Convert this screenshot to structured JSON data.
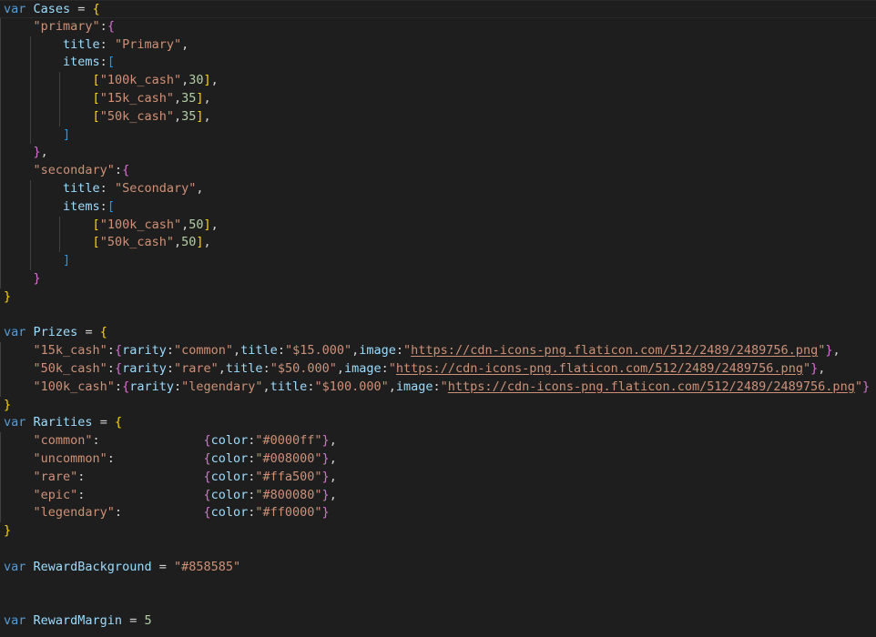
{
  "editor": {
    "language": "javascript",
    "background_color": "#1e1e1e",
    "foreground_color": "#d4d4d4",
    "font_size_px": 13.5,
    "line_height_px": 19.8,
    "current_line": 1,
    "theme_colors": {
      "keyword": "#569cd6",
      "variable": "#9cdcfe",
      "string": "#ce9178",
      "number": "#b5cea8",
      "punctuation": "#d4d4d4",
      "bracket_level_0": "#ffd700",
      "bracket_level_1": "#da70d6",
      "bracket_level_2": "#179fff",
      "indent_guide": "#404040",
      "current_line_border": "#282828"
    }
  },
  "source_values": {
    "cases": {
      "primary": {
        "title": "Primary",
        "items": [
          [
            "100k_cash",
            30
          ],
          [
            "15k_cash",
            35
          ],
          [
            "50k_cash",
            35
          ]
        ]
      },
      "secondary": {
        "title": "Secondary",
        "items": [
          [
            "100k_cash",
            50
          ],
          [
            "50k_cash",
            50
          ]
        ]
      }
    },
    "prizes": {
      "15k_cash": {
        "rarity": "common",
        "title": "$15.000",
        "image": "https://cdn-icons-png.flaticon.com/512/2489/2489756.png"
      },
      "50k_cash": {
        "rarity": "rare",
        "title": "$50.000",
        "image": "https://cdn-icons-png.flaticon.com/512/2489/2489756.png"
      },
      "100k_cash": {
        "rarity": "legendary",
        "title": "$100.000",
        "image": "https://cdn-icons-png.flaticon.com/512/2489/2489756.png"
      }
    },
    "rarities": {
      "common": "#0000ff",
      "uncommon": "#008000",
      "rare": "#ffa500",
      "epic": "#800080",
      "legendary": "#ff0000"
    },
    "reward_background": "#858585",
    "reward_margin": 5
  },
  "lines": [
    {
      "n": 1,
      "current": true,
      "guides": [],
      "tokens": [
        {
          "c": "t-kw",
          "t": "var"
        },
        {
          "c": "t-plain",
          "t": " "
        },
        {
          "c": "t-var",
          "t": "Cases"
        },
        {
          "c": "t-plain",
          "t": " = "
        },
        {
          "c": "t-b0",
          "t": "{"
        }
      ]
    },
    {
      "n": 2,
      "current": false,
      "guides": [
        0
      ],
      "tokens": [
        {
          "c": "t-plain",
          "t": "    "
        },
        {
          "c": "t-str",
          "t": "\"primary\""
        },
        {
          "c": "t-plain",
          "t": ":"
        },
        {
          "c": "t-b1",
          "t": "{"
        }
      ]
    },
    {
      "n": 3,
      "current": false,
      "guides": [
        0,
        1
      ],
      "tokens": [
        {
          "c": "t-plain",
          "t": "        "
        },
        {
          "c": "t-var",
          "t": "title"
        },
        {
          "c": "t-plain",
          "t": ": "
        },
        {
          "c": "t-str",
          "t": "\"Primary\""
        },
        {
          "c": "t-plain",
          "t": ","
        }
      ]
    },
    {
      "n": 4,
      "current": false,
      "guides": [
        0,
        1
      ],
      "tokens": [
        {
          "c": "t-plain",
          "t": "        "
        },
        {
          "c": "t-var",
          "t": "items"
        },
        {
          "c": "t-plain",
          "t": ":"
        },
        {
          "c": "t-b2",
          "t": "["
        }
      ]
    },
    {
      "n": 5,
      "current": false,
      "guides": [
        0,
        1,
        2
      ],
      "tokens": [
        {
          "c": "t-plain",
          "t": "            "
        },
        {
          "c": "t-b0",
          "t": "["
        },
        {
          "c": "t-str",
          "t": "\"100k_cash\""
        },
        {
          "c": "t-plain",
          "t": ","
        },
        {
          "c": "t-num",
          "t": "30"
        },
        {
          "c": "t-b0",
          "t": "]"
        },
        {
          "c": "t-plain",
          "t": ","
        }
      ]
    },
    {
      "n": 6,
      "current": false,
      "guides": [
        0,
        1,
        2
      ],
      "tokens": [
        {
          "c": "t-plain",
          "t": "            "
        },
        {
          "c": "t-b0",
          "t": "["
        },
        {
          "c": "t-str",
          "t": "\"15k_cash\""
        },
        {
          "c": "t-plain",
          "t": ","
        },
        {
          "c": "t-num",
          "t": "35"
        },
        {
          "c": "t-b0",
          "t": "]"
        },
        {
          "c": "t-plain",
          "t": ","
        }
      ]
    },
    {
      "n": 7,
      "current": false,
      "guides": [
        0,
        1,
        2
      ],
      "tokens": [
        {
          "c": "t-plain",
          "t": "            "
        },
        {
          "c": "t-b0",
          "t": "["
        },
        {
          "c": "t-str",
          "t": "\"50k_cash\""
        },
        {
          "c": "t-plain",
          "t": ","
        },
        {
          "c": "t-num",
          "t": "35"
        },
        {
          "c": "t-b0",
          "t": "]"
        },
        {
          "c": "t-plain",
          "t": ","
        }
      ]
    },
    {
      "n": 8,
      "current": false,
      "guides": [
        0,
        1
      ],
      "tokens": [
        {
          "c": "t-plain",
          "t": "        "
        },
        {
          "c": "t-b2",
          "t": "]"
        }
      ]
    },
    {
      "n": 9,
      "current": false,
      "guides": [
        0
      ],
      "tokens": [
        {
          "c": "t-plain",
          "t": "    "
        },
        {
          "c": "t-b1",
          "t": "}"
        },
        {
          "c": "t-plain",
          "t": ","
        }
      ]
    },
    {
      "n": 10,
      "current": false,
      "guides": [
        0
      ],
      "tokens": [
        {
          "c": "t-plain",
          "t": "    "
        },
        {
          "c": "t-str",
          "t": "\"secondary\""
        },
        {
          "c": "t-plain",
          "t": ":"
        },
        {
          "c": "t-b1",
          "t": "{"
        }
      ]
    },
    {
      "n": 11,
      "current": false,
      "guides": [
        0,
        1
      ],
      "tokens": [
        {
          "c": "t-plain",
          "t": "        "
        },
        {
          "c": "t-var",
          "t": "title"
        },
        {
          "c": "t-plain",
          "t": ": "
        },
        {
          "c": "t-str",
          "t": "\"Secondary\""
        },
        {
          "c": "t-plain",
          "t": ","
        }
      ]
    },
    {
      "n": 12,
      "current": false,
      "guides": [
        0,
        1
      ],
      "tokens": [
        {
          "c": "t-plain",
          "t": "        "
        },
        {
          "c": "t-var",
          "t": "items"
        },
        {
          "c": "t-plain",
          "t": ":"
        },
        {
          "c": "t-b2",
          "t": "["
        }
      ]
    },
    {
      "n": 13,
      "current": false,
      "guides": [
        0,
        1,
        2
      ],
      "tokens": [
        {
          "c": "t-plain",
          "t": "            "
        },
        {
          "c": "t-b0",
          "t": "["
        },
        {
          "c": "t-str",
          "t": "\"100k_cash\""
        },
        {
          "c": "t-plain",
          "t": ","
        },
        {
          "c": "t-num",
          "t": "50"
        },
        {
          "c": "t-b0",
          "t": "]"
        },
        {
          "c": "t-plain",
          "t": ","
        }
      ]
    },
    {
      "n": 14,
      "current": false,
      "guides": [
        0,
        1,
        2
      ],
      "tokens": [
        {
          "c": "t-plain",
          "t": "            "
        },
        {
          "c": "t-b0",
          "t": "["
        },
        {
          "c": "t-str",
          "t": "\"50k_cash\""
        },
        {
          "c": "t-plain",
          "t": ","
        },
        {
          "c": "t-num",
          "t": "50"
        },
        {
          "c": "t-b0",
          "t": "]"
        },
        {
          "c": "t-plain",
          "t": ","
        }
      ]
    },
    {
      "n": 15,
      "current": false,
      "guides": [
        0,
        1
      ],
      "tokens": [
        {
          "c": "t-plain",
          "t": "        "
        },
        {
          "c": "t-b2",
          "t": "]"
        }
      ]
    },
    {
      "n": 16,
      "current": false,
      "guides": [
        0
      ],
      "tokens": [
        {
          "c": "t-plain",
          "t": "    "
        },
        {
          "c": "t-b1",
          "t": "}"
        }
      ]
    },
    {
      "n": 17,
      "current": false,
      "guides": [],
      "tokens": [
        {
          "c": "t-b0",
          "t": "}"
        }
      ]
    },
    {
      "n": 18,
      "current": false,
      "guides": [],
      "tokens": []
    },
    {
      "n": 19,
      "current": false,
      "guides": [],
      "tokens": [
        {
          "c": "t-kw",
          "t": "var"
        },
        {
          "c": "t-plain",
          "t": " "
        },
        {
          "c": "t-var",
          "t": "Prizes"
        },
        {
          "c": "t-plain",
          "t": " = "
        },
        {
          "c": "t-b0",
          "t": "{"
        }
      ]
    },
    {
      "n": 20,
      "current": false,
      "guides": [
        0
      ],
      "tokens": [
        {
          "c": "t-plain",
          "t": "    "
        },
        {
          "c": "t-str",
          "t": "\"15k_cash\""
        },
        {
          "c": "t-plain",
          "t": ":"
        },
        {
          "c": "t-b1",
          "t": "{"
        },
        {
          "c": "t-var",
          "t": "rarity"
        },
        {
          "c": "t-plain",
          "t": ":"
        },
        {
          "c": "t-str",
          "t": "\"common\""
        },
        {
          "c": "t-plain",
          "t": ","
        },
        {
          "c": "t-var",
          "t": "title"
        },
        {
          "c": "t-plain",
          "t": ":"
        },
        {
          "c": "t-str",
          "t": "\"$15.000\""
        },
        {
          "c": "t-plain",
          "t": ","
        },
        {
          "c": "t-var",
          "t": "image"
        },
        {
          "c": "t-plain",
          "t": ":"
        },
        {
          "c": "t-str",
          "t": "\""
        },
        {
          "c": "t-link",
          "t": "https://cdn-icons-png.flaticon.com/512/2489/2489756.png"
        },
        {
          "c": "t-str",
          "t": "\""
        },
        {
          "c": "t-b1",
          "t": "}"
        },
        {
          "c": "t-plain",
          "t": ","
        }
      ]
    },
    {
      "n": 21,
      "current": false,
      "guides": [
        0
      ],
      "tokens": [
        {
          "c": "t-plain",
          "t": "    "
        },
        {
          "c": "t-str",
          "t": "\"50k_cash\""
        },
        {
          "c": "t-plain",
          "t": ":"
        },
        {
          "c": "t-b1",
          "t": "{"
        },
        {
          "c": "t-var",
          "t": "rarity"
        },
        {
          "c": "t-plain",
          "t": ":"
        },
        {
          "c": "t-str",
          "t": "\"rare\""
        },
        {
          "c": "t-plain",
          "t": ","
        },
        {
          "c": "t-var",
          "t": "title"
        },
        {
          "c": "t-plain",
          "t": ":"
        },
        {
          "c": "t-str",
          "t": "\"$50.000\""
        },
        {
          "c": "t-plain",
          "t": ","
        },
        {
          "c": "t-var",
          "t": "image"
        },
        {
          "c": "t-plain",
          "t": ":"
        },
        {
          "c": "t-str",
          "t": "\""
        },
        {
          "c": "t-link",
          "t": "https://cdn-icons-png.flaticon.com/512/2489/2489756.png"
        },
        {
          "c": "t-str",
          "t": "\""
        },
        {
          "c": "t-b1",
          "t": "}"
        },
        {
          "c": "t-plain",
          "t": ","
        }
      ]
    },
    {
      "n": 22,
      "current": false,
      "guides": [
        0
      ],
      "tokens": [
        {
          "c": "t-plain",
          "t": "    "
        },
        {
          "c": "t-str",
          "t": "\"100k_cash\""
        },
        {
          "c": "t-plain",
          "t": ":"
        },
        {
          "c": "t-b1",
          "t": "{"
        },
        {
          "c": "t-var",
          "t": "rarity"
        },
        {
          "c": "t-plain",
          "t": ":"
        },
        {
          "c": "t-str",
          "t": "\"legendary\""
        },
        {
          "c": "t-plain",
          "t": ","
        },
        {
          "c": "t-var",
          "t": "title"
        },
        {
          "c": "t-plain",
          "t": ":"
        },
        {
          "c": "t-str",
          "t": "\"$100.000\""
        },
        {
          "c": "t-plain",
          "t": ","
        },
        {
          "c": "t-var",
          "t": "image"
        },
        {
          "c": "t-plain",
          "t": ":"
        },
        {
          "c": "t-str",
          "t": "\""
        },
        {
          "c": "t-link",
          "t": "https://cdn-icons-png.flaticon.com/512/2489/2489756.png"
        },
        {
          "c": "t-str",
          "t": "\""
        },
        {
          "c": "t-b1",
          "t": "}"
        }
      ]
    },
    {
      "n": 23,
      "current": false,
      "guides": [],
      "tokens": [
        {
          "c": "t-b0",
          "t": "}"
        }
      ]
    },
    {
      "n": 24,
      "current": false,
      "guides": [],
      "tokens": [
        {
          "c": "t-kw",
          "t": "var"
        },
        {
          "c": "t-plain",
          "t": " "
        },
        {
          "c": "t-var",
          "t": "Rarities"
        },
        {
          "c": "t-plain",
          "t": " = "
        },
        {
          "c": "t-b0",
          "t": "{"
        }
      ]
    },
    {
      "n": 25,
      "current": false,
      "guides": [
        0
      ],
      "tokens": [
        {
          "c": "t-plain",
          "t": "    "
        },
        {
          "c": "t-str",
          "t": "\"common\""
        },
        {
          "c": "t-plain",
          "t": ":              "
        },
        {
          "c": "t-b1",
          "t": "{"
        },
        {
          "c": "t-var",
          "t": "color"
        },
        {
          "c": "t-plain",
          "t": ":"
        },
        {
          "c": "t-str",
          "t": "\"#0000ff\""
        },
        {
          "c": "t-b1",
          "t": "}"
        },
        {
          "c": "t-plain",
          "t": ","
        }
      ]
    },
    {
      "n": 26,
      "current": false,
      "guides": [
        0
      ],
      "tokens": [
        {
          "c": "t-plain",
          "t": "    "
        },
        {
          "c": "t-str",
          "t": "\"uncommon\""
        },
        {
          "c": "t-plain",
          "t": ":            "
        },
        {
          "c": "t-b1",
          "t": "{"
        },
        {
          "c": "t-var",
          "t": "color"
        },
        {
          "c": "t-plain",
          "t": ":"
        },
        {
          "c": "t-str",
          "t": "\"#008000\""
        },
        {
          "c": "t-b1",
          "t": "}"
        },
        {
          "c": "t-plain",
          "t": ","
        }
      ]
    },
    {
      "n": 27,
      "current": false,
      "guides": [
        0
      ],
      "tokens": [
        {
          "c": "t-plain",
          "t": "    "
        },
        {
          "c": "t-str",
          "t": "\"rare\""
        },
        {
          "c": "t-plain",
          "t": ":                "
        },
        {
          "c": "t-b1",
          "t": "{"
        },
        {
          "c": "t-var",
          "t": "color"
        },
        {
          "c": "t-plain",
          "t": ":"
        },
        {
          "c": "t-str",
          "t": "\"#ffa500\""
        },
        {
          "c": "t-b1",
          "t": "}"
        },
        {
          "c": "t-plain",
          "t": ","
        }
      ]
    },
    {
      "n": 28,
      "current": false,
      "guides": [
        0
      ],
      "tokens": [
        {
          "c": "t-plain",
          "t": "    "
        },
        {
          "c": "t-str",
          "t": "\"epic\""
        },
        {
          "c": "t-plain",
          "t": ":                "
        },
        {
          "c": "t-b1",
          "t": "{"
        },
        {
          "c": "t-var",
          "t": "color"
        },
        {
          "c": "t-plain",
          "t": ":"
        },
        {
          "c": "t-str",
          "t": "\"#800080\""
        },
        {
          "c": "t-b1",
          "t": "}"
        },
        {
          "c": "t-plain",
          "t": ","
        }
      ]
    },
    {
      "n": 29,
      "current": false,
      "guides": [
        0
      ],
      "tokens": [
        {
          "c": "t-plain",
          "t": "    "
        },
        {
          "c": "t-str",
          "t": "\"legendary\""
        },
        {
          "c": "t-plain",
          "t": ":           "
        },
        {
          "c": "t-b1",
          "t": "{"
        },
        {
          "c": "t-var",
          "t": "color"
        },
        {
          "c": "t-plain",
          "t": ":"
        },
        {
          "c": "t-str",
          "t": "\"#ff0000\""
        },
        {
          "c": "t-b1",
          "t": "}"
        }
      ]
    },
    {
      "n": 30,
      "current": false,
      "guides": [],
      "tokens": [
        {
          "c": "t-b0",
          "t": "}"
        }
      ]
    },
    {
      "n": 31,
      "current": false,
      "guides": [],
      "tokens": []
    },
    {
      "n": 32,
      "current": false,
      "guides": [],
      "tokens": [
        {
          "c": "t-kw",
          "t": "var"
        },
        {
          "c": "t-plain",
          "t": " "
        },
        {
          "c": "t-var",
          "t": "RewardBackground"
        },
        {
          "c": "t-plain",
          "t": " = "
        },
        {
          "c": "t-str",
          "t": "\"#858585\""
        }
      ]
    },
    {
      "n": 33,
      "current": false,
      "guides": [],
      "tokens": []
    },
    {
      "n": 34,
      "current": false,
      "guides": [],
      "tokens": []
    },
    {
      "n": 35,
      "current": false,
      "guides": [],
      "tokens": [
        {
          "c": "t-kw",
          "t": "var"
        },
        {
          "c": "t-plain",
          "t": " "
        },
        {
          "c": "t-var",
          "t": "RewardMargin"
        },
        {
          "c": "t-plain",
          "t": " = "
        },
        {
          "c": "t-num",
          "t": "5"
        }
      ]
    }
  ]
}
